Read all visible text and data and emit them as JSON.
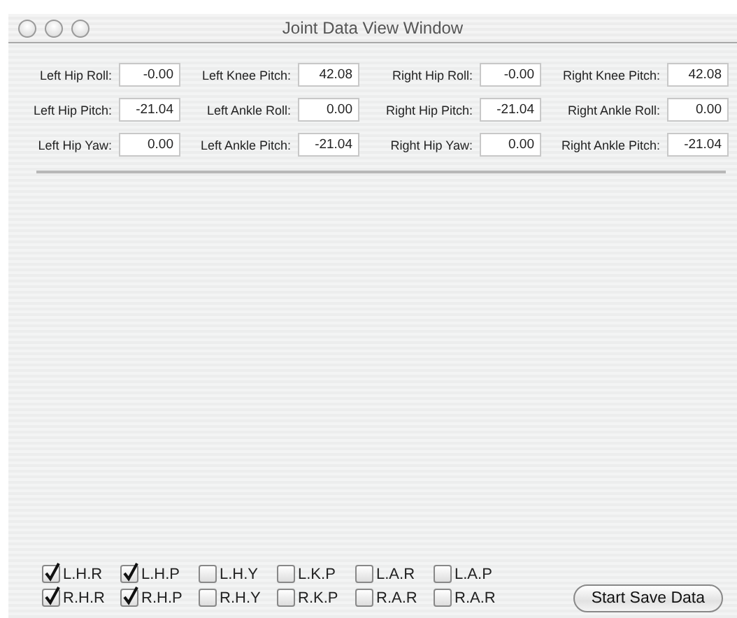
{
  "window": {
    "title": "Joint Data View Window"
  },
  "fields": [
    {
      "label": "Left Hip Roll:",
      "value": "-0.00"
    },
    {
      "label": "Left Knee Pitch:",
      "value": "42.08"
    },
    {
      "label": "Right Hip Roll:",
      "value": "-0.00"
    },
    {
      "label": "Right Knee Pitch:",
      "value": "42.08"
    },
    {
      "label": "Left Hip Pitch:",
      "value": "-21.04"
    },
    {
      "label": "Left Ankle Roll:",
      "value": "0.00"
    },
    {
      "label": "Right Hip Pitch:",
      "value": "-21.04"
    },
    {
      "label": "Right Ankle Roll:",
      "value": "0.00"
    },
    {
      "label": "Left Hip Yaw:",
      "value": "0.00"
    },
    {
      "label": "Left Ankle Pitch:",
      "value": "-21.04"
    },
    {
      "label": "Right Hip Yaw:",
      "value": "0.00"
    },
    {
      "label": "Right Ankle Pitch:",
      "value": "-21.04"
    }
  ],
  "checkboxes": [
    {
      "label": "L.H.R",
      "checked": true
    },
    {
      "label": "L.H.P",
      "checked": true
    },
    {
      "label": "L.H.Y",
      "checked": false
    },
    {
      "label": "L.K.P",
      "checked": false
    },
    {
      "label": "L.A.R",
      "checked": false
    },
    {
      "label": "L.A.P",
      "checked": false
    },
    {
      "label": "R.H.R",
      "checked": true
    },
    {
      "label": "R.H.P",
      "checked": true
    },
    {
      "label": "R.H.Y",
      "checked": false
    },
    {
      "label": "R.K.P",
      "checked": false
    },
    {
      "label": "R.A.R",
      "checked": false
    },
    {
      "label": "R.A.R",
      "checked": false
    }
  ],
  "button": "Start Save Data"
}
